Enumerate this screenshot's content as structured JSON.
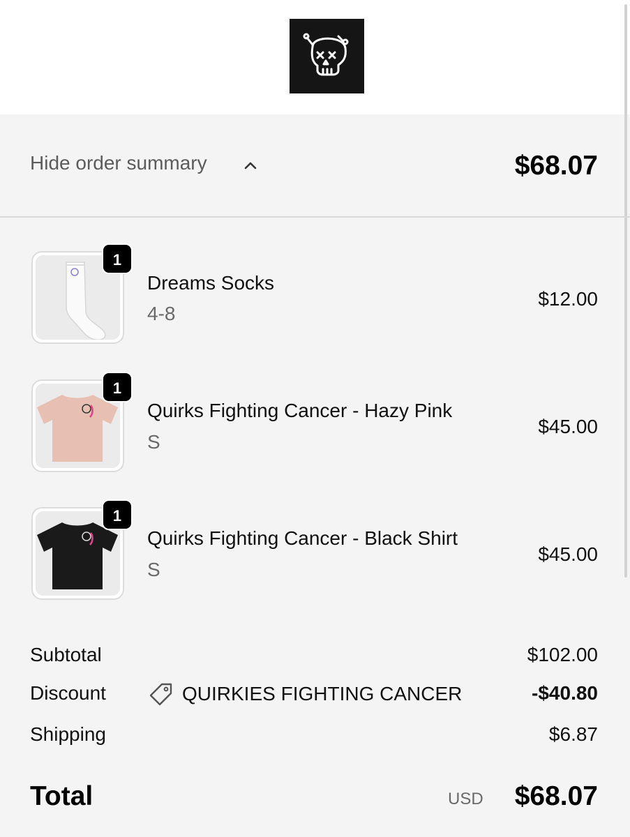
{
  "header": {
    "logo": "skull-logo-icon"
  },
  "summary_toggle": {
    "label": "Hide order summary",
    "icon": "chevron-up-icon",
    "total": "$68.07"
  },
  "items": [
    {
      "name": "Dreams Socks",
      "variant": "4-8",
      "price": "$12.00",
      "quantity": "1",
      "image": "white-socks"
    },
    {
      "name": "Quirks Fighting Cancer - Hazy Pink",
      "variant": "S",
      "price": "$45.00",
      "quantity": "1",
      "image": "pink-tshirt"
    },
    {
      "name": "Quirks Fighting Cancer - Black Shirt",
      "variant": "S",
      "price": "$45.00",
      "quantity": "1",
      "image": "black-tshirt"
    }
  ],
  "totals": {
    "subtotal_label": "Subtotal",
    "subtotal": "$102.00",
    "discount_label": "Discount",
    "discount_code": "QUIRKIES FIGHTING CANCER",
    "discount_icon": "tag-icon",
    "discount": "-$40.80",
    "shipping_label": "Shipping",
    "shipping": "$6.87",
    "total_label": "Total",
    "currency": "USD",
    "total": "$68.07"
  },
  "colors": {
    "pink_shirt": "#e7c0b3",
    "black_shirt": "#1a1a1a",
    "badge": "#000000",
    "ribbon": "#e83f8c"
  }
}
